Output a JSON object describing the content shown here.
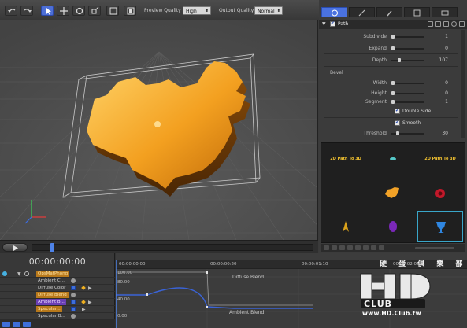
{
  "toolbar": {
    "tools": [
      "undo-icon",
      "redo-icon",
      "select-arrow-icon",
      "move-icon",
      "rotate-icon",
      "scale-icon",
      "frame-icon",
      "camera-icon"
    ],
    "preview_quality_label": "Preview Quality",
    "preview_quality_value": "High",
    "output_quality_label": "Output Quality",
    "output_quality_value": "Normal"
  },
  "right_panel": {
    "tabs": [
      "object-tab",
      "material-tab",
      "paint-tab",
      "layers-tab",
      "settings-tab"
    ],
    "header_title": "Path",
    "properties": [
      {
        "label": "Subdivide",
        "value": "1"
      },
      {
        "label": "Expand",
        "value": "0"
      },
      {
        "label": "Depth",
        "value": "107"
      }
    ],
    "bevel_label": "Bevel",
    "bevel_properties": [
      {
        "label": "Width",
        "value": "0"
      },
      {
        "label": "Height",
        "value": "0"
      },
      {
        "label": "Segment",
        "value": "1"
      }
    ],
    "double_side_label": "Double Side",
    "smooth_label": "Smooth",
    "threshold_label": "Threshold",
    "threshold_value": "30"
  },
  "library": {
    "items": [
      {
        "label": "2D Path To 3D"
      },
      {
        "label": ""
      },
      {
        "label": "2D Path To 3D"
      },
      {
        "label": ""
      },
      {
        "label": ""
      },
      {
        "label": ""
      },
      {
        "label": ""
      },
      {
        "label": ""
      },
      {
        "label": ""
      }
    ]
  },
  "timeline": {
    "time": "00:00:00:00",
    "tracks": [
      {
        "name": "OpsMatPhong"
      },
      {
        "name": "Ambient C..."
      },
      {
        "name": "Diffuse Color"
      },
      {
        "name": "Diffuse Blend"
      },
      {
        "name": "Ambient B..."
      },
      {
        "name": "Specular..."
      },
      {
        "name": "Specular B..."
      }
    ],
    "ruler_labels": [
      "00:00:00:00",
      "00:00:00:20",
      "00:00:01:10",
      "00:00:02:00"
    ],
    "y_labels": [
      "100.00",
      "80.00",
      "40.00",
      "0.00"
    ],
    "curve_labels": [
      "Diffuse Blend",
      "Ambient Blend"
    ]
  },
  "watermark": {
    "cjk": "硬 蛋 俱 樂 部",
    "url": "www.HD.Club.tw"
  }
}
